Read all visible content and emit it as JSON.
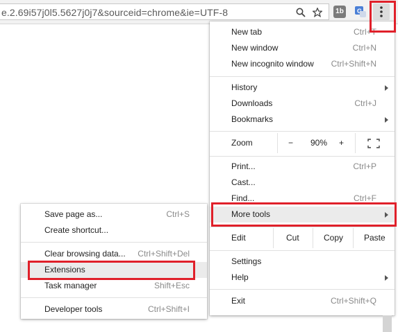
{
  "omnibox": {
    "url": "e.2.69i57j0l5.5627j0j7&sourceid=chrome&ie=UTF-8"
  },
  "toolbar": {
    "icons": [
      "search-icon",
      "star-icon",
      "onetab-extension-icon",
      "translate-extension-icon",
      "more-vert-icon"
    ],
    "onetab_text": "1b"
  },
  "main_menu": {
    "new_tab": {
      "label": "New tab",
      "shortcut": "Ctrl+T"
    },
    "new_window": {
      "label": "New window",
      "shortcut": "Ctrl+N"
    },
    "new_incognito": {
      "label": "New incognito window",
      "shortcut": "Ctrl+Shift+N"
    },
    "history": {
      "label": "History"
    },
    "downloads": {
      "label": "Downloads",
      "shortcut": "Ctrl+J"
    },
    "bookmarks": {
      "label": "Bookmarks"
    },
    "zoom": {
      "label": "Zoom",
      "minus": "−",
      "value": "90%",
      "plus": "+"
    },
    "print": {
      "label": "Print...",
      "shortcut": "Ctrl+P"
    },
    "cast": {
      "label": "Cast..."
    },
    "find": {
      "label": "Find...",
      "shortcut": "Ctrl+F"
    },
    "more_tools": {
      "label": "More tools"
    },
    "edit": {
      "label": "Edit",
      "cut": "Cut",
      "copy": "Copy",
      "paste": "Paste"
    },
    "settings": {
      "label": "Settings"
    },
    "help": {
      "label": "Help"
    },
    "exit": {
      "label": "Exit",
      "shortcut": "Ctrl+Shift+Q"
    }
  },
  "more_tools_menu": {
    "save_page": {
      "label": "Save page as...",
      "shortcut": "Ctrl+S"
    },
    "create_shortcut": {
      "label": "Create shortcut..."
    },
    "clear_browsing": {
      "label": "Clear browsing data...",
      "shortcut": "Ctrl+Shift+Del"
    },
    "extensions": {
      "label": "Extensions"
    },
    "task_manager": {
      "label": "Task manager",
      "shortcut": "Shift+Esc"
    },
    "developer_tools": {
      "label": "Developer tools",
      "shortcut": "Ctrl+Shift+I"
    }
  },
  "colors": {
    "highlight_box": "#e0202a",
    "hover_row": "#ebebeb",
    "translate_blue": "#4a7fd6"
  }
}
